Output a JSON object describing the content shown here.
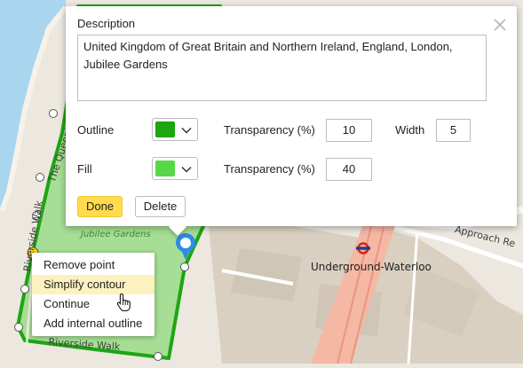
{
  "map": {
    "street_queens_walk": "The Queen's Walk",
    "street_riverside_walk_left": "Riverside Walk",
    "street_riverside_walk_bottom": "Riverside Walk",
    "park_name": "Jubilee Gardens",
    "station_name": "Underground-Waterloo",
    "road_approach": "Approach Re"
  },
  "popup": {
    "description_label": "Description",
    "description_value": "United Kingdom of Great Britain and Northern Ireland, England, London, Jubilee Gardens",
    "outline_label": "Outline",
    "fill_label": "Fill",
    "outline_transparency_label": "Transparency (%)",
    "outline_transparency_value": "10",
    "width_label": "Width",
    "width_value": "5",
    "fill_transparency_label": "Transparency (%)",
    "fill_transparency_value": "40",
    "outline_color": "#1ea512",
    "fill_color": "#58d846",
    "done_label": "Done",
    "delete_label": "Delete"
  },
  "context_menu": {
    "items": [
      {
        "label": "Remove point"
      },
      {
        "label": "Simplify contour"
      },
      {
        "label": "Continue"
      },
      {
        "label": "Add internal outline"
      }
    ],
    "highlighted_index": 1
  },
  "icons": {
    "close": "close-icon",
    "chevron": "chevron-down-icon",
    "marker": "map-marker-icon",
    "cursor": "hand-pointer-cursor",
    "underground": "underground-logo-icon"
  }
}
